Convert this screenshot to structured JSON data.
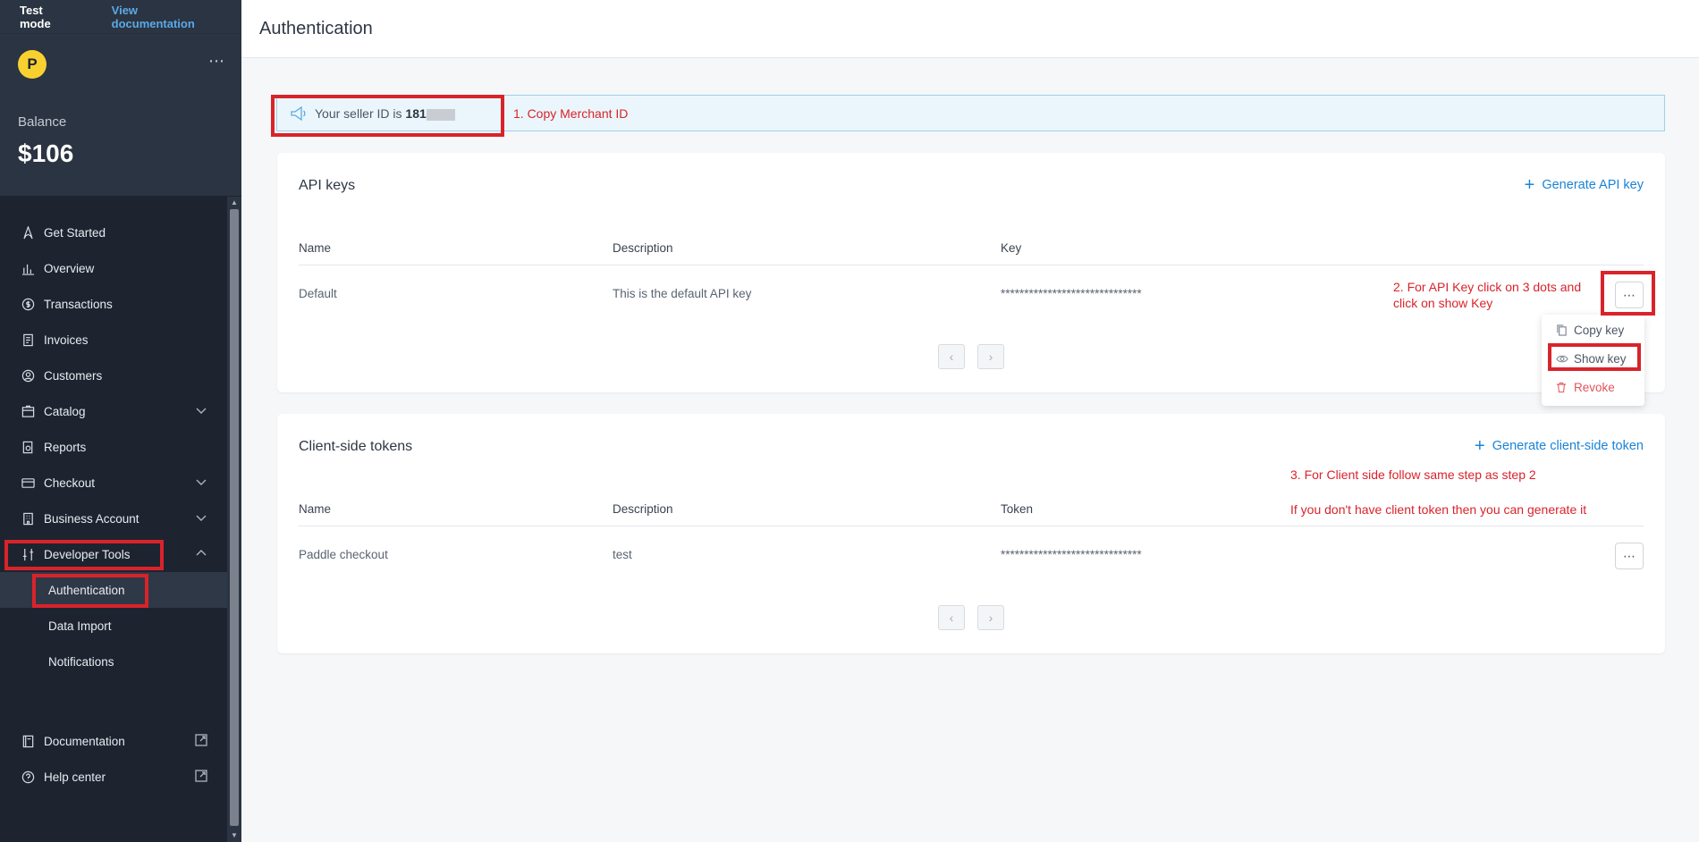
{
  "sidebar": {
    "test_mode": "Test mode",
    "view_docs": "View documentation",
    "logo_letter": "P",
    "balance_label": "Balance",
    "balance_value": "$106",
    "nav": {
      "get_started": "Get Started",
      "overview": "Overview",
      "transactions": "Transactions",
      "invoices": "Invoices",
      "customers": "Customers",
      "catalog": "Catalog",
      "reports": "Reports",
      "checkout": "Checkout",
      "business_account": "Business Account",
      "developer_tools": "Developer Tools",
      "authentication": "Authentication",
      "data_import": "Data Import",
      "notifications": "Notifications",
      "documentation": "Documentation",
      "help_center": "Help center"
    }
  },
  "header": {
    "title": "Authentication"
  },
  "seller": {
    "prefix": "Your seller ID is ",
    "id_visible": "181"
  },
  "api_keys": {
    "title": "API keys",
    "generate_label": "Generate API key",
    "columns": {
      "name": "Name",
      "description": "Description",
      "key": "Key"
    },
    "rows": [
      {
        "name": "Default",
        "description": "This is the default API key",
        "key": "******************************"
      }
    ],
    "menu": {
      "copy": "Copy key",
      "show": "Show key",
      "revoke": "Revoke"
    }
  },
  "client_tokens": {
    "title": "Client-side tokens",
    "generate_label": "Generate client-side token",
    "columns": {
      "name": "Name",
      "description": "Description",
      "token": "Token"
    },
    "rows": [
      {
        "name": "Paddle checkout",
        "description": "test",
        "token": "******************************"
      }
    ]
  },
  "annotations": {
    "step1": "1. Copy Merchant ID",
    "step2_line1": "2. For API Key click on 3 dots and",
    "step2_line2": "click on show Key",
    "step3": "3. For Client side follow same step as step 2",
    "step3_note": "If you don't have client token then you can generate it"
  },
  "colors": {
    "accent": "#1a83d6",
    "sidebar_bg": "#1d2430",
    "annotation_red": "#d9232b",
    "danger": "#e2545d"
  },
  "icons": [
    "rocket-icon",
    "bar-chart-icon",
    "dollar-icon",
    "invoice-icon",
    "user-circle-icon",
    "catalog-icon",
    "reports-icon",
    "card-icon",
    "building-icon",
    "sliders-icon",
    "book-icon",
    "help-icon",
    "external-link-icon",
    "megaphone-icon",
    "copy-icon",
    "eye-icon",
    "trash-icon"
  ]
}
